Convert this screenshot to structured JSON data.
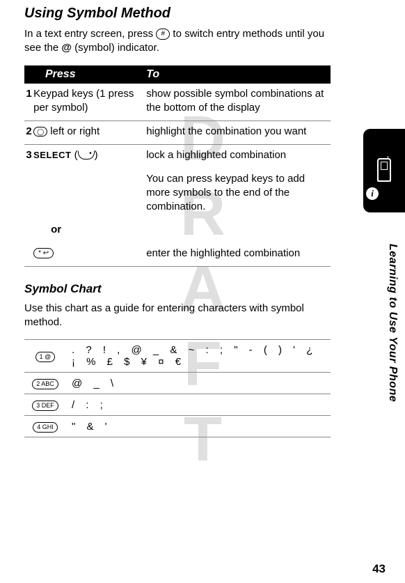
{
  "watermark": "DRAFT",
  "title": "Using Symbol Method",
  "intro_before_key": "In a text entry screen, press ",
  "intro_key": "#",
  "intro_middle": " to switch entry methods until you see the ",
  "symbol_indicator": "@",
  "intro_after": " (symbol) indicator.",
  "table_headers": {
    "press": "Press",
    "to": "To"
  },
  "rows": {
    "r1": {
      "num": "1",
      "press": "Keypad keys (1 press per symbol)",
      "to": "show possible symbol combinations at the bottom of the display"
    },
    "r2": {
      "num": "2",
      "press_after": " left or right",
      "to": "highlight the combination you want"
    },
    "r3": {
      "num": "3",
      "select": "SELECT",
      "press_paren": " (",
      "press_paren_close": ")",
      "to": "lock a highlighted combination",
      "to2": "You can press keypad keys to add more symbols to the end of the combination."
    },
    "or": "or",
    "r4": {
      "key": "*",
      "to": "enter the highlighted combination"
    }
  },
  "chart_title": "Symbol Chart",
  "chart_intro": "Use this chart as a guide for entering characters with symbol method.",
  "chart": {
    "k1": {
      "key": "1 @",
      "symbols": ". ? ! , @ _ & ~ : ; \" - ( ) ' ¿ ¡ % £ $ ¥ ¤ €"
    },
    "k2": {
      "key": "2 ABC",
      "symbols": "@ _ \\"
    },
    "k3": {
      "key": "3 DEF",
      "symbols": "/ : ;"
    },
    "k4": {
      "key": "4 GHI",
      "symbols": "\" & '"
    }
  },
  "sidebar_text": "Learning to Use Your Phone",
  "info_icon": "i",
  "page_number": "43"
}
